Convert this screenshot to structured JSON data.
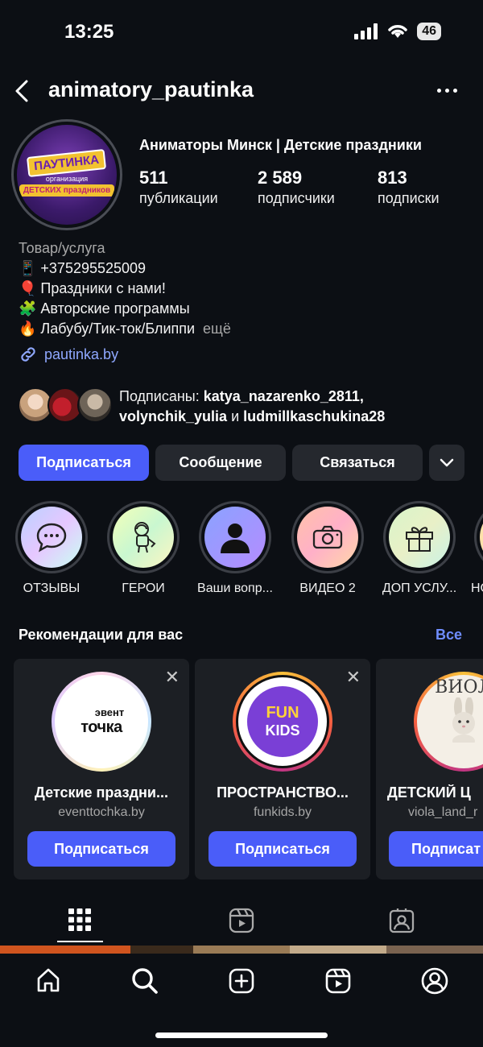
{
  "status": {
    "time": "13:25",
    "battery": "46"
  },
  "header": {
    "username": "animatory_pautinka"
  },
  "profile": {
    "avatar_text": {
      "top": "ПАУТИНКА",
      "mid": "организация",
      "bot": "ДЕТСКИХ праздников"
    },
    "full_name": "Аниматоры Минск | Детские праздники",
    "stats": [
      {
        "num": "511",
        "label": "публикации"
      },
      {
        "num": "2 589",
        "label": "подписчики"
      },
      {
        "num": "813",
        "label": "подписки"
      }
    ],
    "category": "Товар/услуга",
    "bio_lines": [
      "📱 +375295525009",
      "🎈 Праздники с нами!",
      "🧩 Авторские программы",
      "🔥 Лабубу/Тик-ток/Блиппи"
    ],
    "more_label": "ещё",
    "link": "pautinka.by",
    "followed_prefix": "Подписаны:",
    "followed_user1": "katya_nazarenko_2811,",
    "followed_user2": "volynchik_yulia",
    "followed_and": "и",
    "followed_user3": "ludmillkaschukina28"
  },
  "actions": {
    "follow": "Подписаться",
    "message": "Сообщение",
    "contact": "Связаться"
  },
  "highlights": [
    {
      "label": "ОТЗЫВЫ",
      "icon": "chat-bubble-icon"
    },
    {
      "label": "ГЕРОИ",
      "icon": "astronaut-icon"
    },
    {
      "label": "Ваши вопр...",
      "icon": "person-icon"
    },
    {
      "label": "ВИДЕО 2",
      "icon": "camera-icon"
    },
    {
      "label": "ДОП УСЛУ...",
      "icon": "gift-icon"
    },
    {
      "label": "НС",
      "icon": "highlight-icon"
    }
  ],
  "recommendations": {
    "title": "Рекомендации для вас",
    "all_label": "Все",
    "cards": [
      {
        "name": "Детские праздни...",
        "url": "eventtochka.by",
        "button": "Подписаться",
        "logo_top": "эвент",
        "logo_bot": "точка"
      },
      {
        "name": "ПРОСТРАНСТВО...",
        "url": "funkids.by",
        "button": "Подписаться",
        "logo_top": "FUN",
        "logo_bot": "KIDS"
      },
      {
        "name": "ДЕТСКИЙ Ц",
        "url": "viola_land_r",
        "button": "Подписат",
        "logo_top": "ВИОЛ"
      }
    ]
  },
  "colors": {
    "accent": "#4a5df9",
    "link": "#8fa8ff",
    "background": "#0c0f14"
  }
}
